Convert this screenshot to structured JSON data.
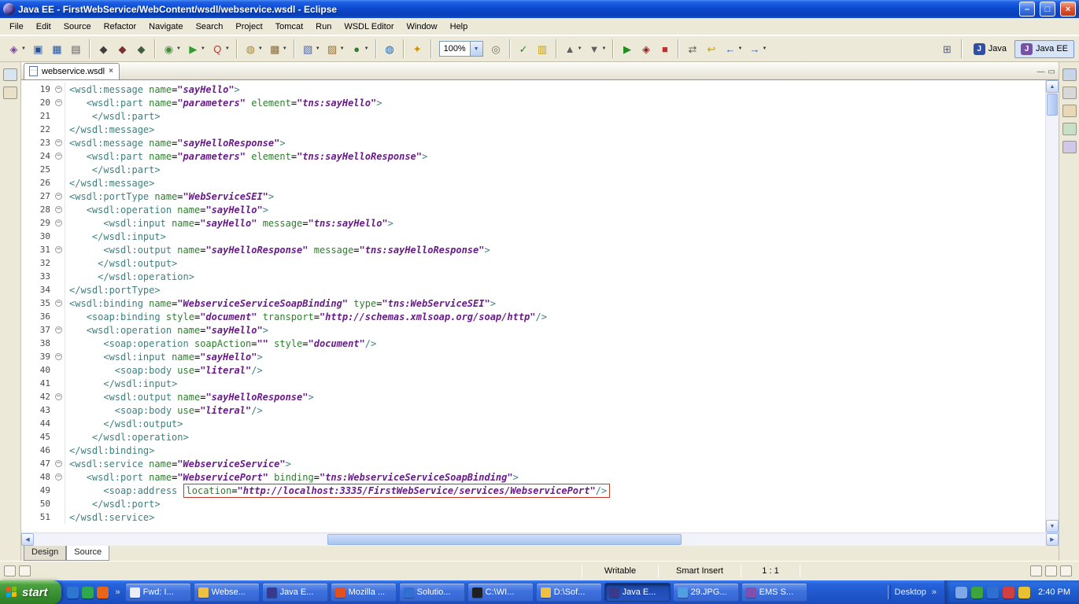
{
  "window": {
    "title": "Java EE - FirstWebService/WebContent/wsdl/webservice.wsdl - Eclipse",
    "controls": {
      "minimize": "–",
      "maximize": "□",
      "close": "×"
    }
  },
  "icons": {
    "dropdown": "▼",
    "up": "▲",
    "down": "▼",
    "left": "◀",
    "right": "▶",
    "overflow": "»"
  },
  "menu": {
    "items": [
      "File",
      "Edit",
      "Source",
      "Refactor",
      "Navigate",
      "Search",
      "Project",
      "Tomcat",
      "Run",
      "WSDL Editor",
      "Window",
      "Help"
    ]
  },
  "toolbar": {
    "zoom_value": "100%",
    "perspectives": [
      {
        "label": "Java"
      },
      {
        "label": "Java EE",
        "active": true
      }
    ],
    "groups": [
      [
        {
          "name": "new-wizard-icon",
          "glyph": "◈",
          "color": "#7B3FA0",
          "dd": true
        },
        {
          "name": "save-icon",
          "glyph": "▣",
          "color": "#24509E"
        },
        {
          "name": "save-all-icon",
          "glyph": "▦",
          "color": "#24509E"
        },
        {
          "name": "print-icon",
          "glyph": "▤",
          "color": "#5A5A5A"
        }
      ],
      [
        {
          "name": "new-ant-build-icon",
          "glyph": "◆",
          "color": "#3E3E3E"
        },
        {
          "name": "ant-debug-icon",
          "glyph": "◆",
          "color": "#7A3030"
        },
        {
          "name": "ant-run-icon",
          "glyph": "◆",
          "color": "#3E5E3E"
        }
      ],
      [
        {
          "name": "debug-icon",
          "glyph": "◉",
          "color": "#3E8E3E",
          "dd": true
        },
        {
          "name": "run-icon",
          "glyph": "▶",
          "color": "#2E9E2E",
          "dd": true
        },
        {
          "name": "external-tools-icon",
          "glyph": "Q",
          "color": "#B03838",
          "dd": true
        }
      ],
      [
        {
          "name": "new-web-service-icon",
          "glyph": "◍",
          "color": "#B8860B",
          "dd": true
        },
        {
          "name": "new-dynamic-web-project-icon",
          "glyph": "▩",
          "color": "#8A6D3B",
          "dd": true
        }
      ],
      [
        {
          "name": "new-java-project-icon",
          "glyph": "▧",
          "color": "#4A6AB0",
          "dd": true
        },
        {
          "name": "new-package-icon",
          "glyph": "▨",
          "color": "#9A7230",
          "dd": true
        },
        {
          "name": "new-class-icon",
          "glyph": "●",
          "color": "#2E7D32",
          "dd": true
        }
      ],
      [
        {
          "name": "web-browser-icon",
          "glyph": "◍",
          "color": "#1565C0"
        }
      ],
      [
        {
          "name": "search-icon",
          "glyph": "✦",
          "color": "#D09000"
        }
      ],
      [
        {
          "type": "zoom"
        },
        {
          "name": "zoom-select-icon",
          "glyph": "◎",
          "color": "#707070"
        }
      ],
      [
        {
          "name": "validate-icon",
          "glyph": "✓",
          "color": "#2E7D32"
        },
        {
          "name": "mark-occurrences-icon",
          "glyph": "▥",
          "color": "#C8A000"
        }
      ],
      [
        {
          "name": "previous-annotation-icon",
          "glyph": "▲",
          "color": "#606060",
          "dd": true
        },
        {
          "name": "next-annotation-icon",
          "glyph": "▼",
          "color": "#606060",
          "dd": true
        }
      ],
      [
        {
          "name": "run-last-icon",
          "glyph": "▶",
          "color": "#1E8E1E"
        },
        {
          "name": "profile-icon",
          "glyph": "◈",
          "color": "#8E1E1E"
        },
        {
          "name": "stop-icon",
          "glyph": "■",
          "color": "#C03030"
        }
      ],
      [
        {
          "name": "link-editor-icon",
          "glyph": "⇄",
          "color": "#606060"
        },
        {
          "name": "last-edit-icon",
          "glyph": "↩",
          "color": "#C8A000"
        },
        {
          "name": "back-icon",
          "glyph": "←",
          "color": "#2B5FC0",
          "dd": true
        },
        {
          "name": "forward-icon",
          "glyph": "→",
          "color": "#2B5FC0",
          "dd": true
        }
      ]
    ]
  },
  "strips": {
    "left": [
      {
        "name": "fast-view-restore-icon",
        "color": "#D8E4F0"
      },
      {
        "name": "fast-view-palette-icon",
        "color": "#E8E0C8"
      }
    ],
    "right": [
      {
        "name": "restore-trim-icon",
        "color": "#C8D4E8"
      },
      {
        "name": "outline-view-icon",
        "color": "#D8D8D8"
      },
      {
        "name": "properties-view-icon",
        "color": "#E8D8B8"
      },
      {
        "name": "servers-view-icon",
        "color": "#C8E0C8"
      },
      {
        "name": "snippets-view-icon",
        "color": "#D0C8E8"
      }
    ]
  },
  "editor": {
    "tab": "webservice.wsdl",
    "tab_close": "×",
    "minimize_glyph": "—",
    "maximize_glyph": "▭",
    "fold_glyph": "−",
    "view_tabs": [
      "Design",
      "Source"
    ],
    "lines": [
      {
        "n": 19,
        "fold": true,
        "text": "<wsdl:message name=\"sayHello\">"
      },
      {
        "n": 20,
        "fold": true,
        "text": "   <wsdl:part name=\"parameters\" element=\"tns:sayHello\">"
      },
      {
        "n": 21,
        "fold": false,
        "text": "    </wsdl:part>"
      },
      {
        "n": 22,
        "fold": false,
        "text": "</wsdl:message>"
      },
      {
        "n": 23,
        "fold": true,
        "text": "<wsdl:message name=\"sayHelloResponse\">"
      },
      {
        "n": 24,
        "fold": true,
        "text": "   <wsdl:part name=\"parameters\" element=\"tns:sayHelloResponse\">"
      },
      {
        "n": 25,
        "fold": false,
        "text": "    </wsdl:part>"
      },
      {
        "n": 26,
        "fold": false,
        "text": "</wsdl:message>"
      },
      {
        "n": 27,
        "fold": true,
        "text": "<wsdl:portType name=\"WebServiceSEI\">"
      },
      {
        "n": 28,
        "fold": true,
        "text": "   <wsdl:operation name=\"sayHello\">"
      },
      {
        "n": 29,
        "fold": true,
        "text": "      <wsdl:input name=\"sayHello\" message=\"tns:sayHello\">"
      },
      {
        "n": 30,
        "fold": false,
        "text": "    </wsdl:input>"
      },
      {
        "n": 31,
        "fold": true,
        "text": "      <wsdl:output name=\"sayHelloResponse\" message=\"tns:sayHelloResponse\">"
      },
      {
        "n": 32,
        "fold": false,
        "text": "     </wsdl:output>"
      },
      {
        "n": 33,
        "fold": false,
        "text": "     </wsdl:operation>"
      },
      {
        "n": 34,
        "fold": false,
        "text": "</wsdl:portType>"
      },
      {
        "n": 35,
        "fold": true,
        "text": "<wsdl:binding name=\"WebserviceServiceSoapBinding\" type=\"tns:WebServiceSEI\">"
      },
      {
        "n": 36,
        "fold": false,
        "text": "   <soap:binding style=\"document\" transport=\"http://schemas.xmlsoap.org/soap/http\"/>"
      },
      {
        "n": 37,
        "fold": true,
        "text": "   <wsdl:operation name=\"sayHello\">"
      },
      {
        "n": 38,
        "fold": false,
        "text": "      <soap:operation soapAction=\"\" style=\"document\"/>"
      },
      {
        "n": 39,
        "fold": true,
        "text": "      <wsdl:input name=\"sayHello\">"
      },
      {
        "n": 40,
        "fold": false,
        "text": "        <soap:body use=\"literal\"/>"
      },
      {
        "n": 41,
        "fold": false,
        "text": "      </wsdl:input>"
      },
      {
        "n": 42,
        "fold": true,
        "text": "      <wsdl:output name=\"sayHelloResponse\">"
      },
      {
        "n": 43,
        "fold": false,
        "text": "        <soap:body use=\"literal\"/>"
      },
      {
        "n": 44,
        "fold": false,
        "text": "      </wsdl:output>"
      },
      {
        "n": 45,
        "fold": false,
        "text": "    </wsdl:operation>"
      },
      {
        "n": 46,
        "fold": false,
        "text": "</wsdl:binding>"
      },
      {
        "n": 47,
        "fold": true,
        "text": "<wsdl:service name=\"WebserviceService\">"
      },
      {
        "n": 48,
        "fold": true,
        "text": "   <wsdl:port name=\"WebservicePort\" binding=\"tns:WebserviceServiceSoapBinding\">"
      },
      {
        "n": 49,
        "fold": false,
        "text": "      <soap:address location=\"http://localhost:3335/FirstWebService/services/WebservicePort\"/>",
        "hl": "location="
      },
      {
        "n": 50,
        "fold": false,
        "text": "    </wsdl:port>"
      },
      {
        "n": 51,
        "fold": false,
        "text": "</wsdl:service>"
      }
    ]
  },
  "status": {
    "writable": "Writable",
    "insert_mode": "Smart Insert",
    "position": "1 : 1"
  },
  "taskbar": {
    "start_label": "start",
    "quick_launch": [
      {
        "name": "internet-explorer-icon",
        "color": "#2E77D0"
      },
      {
        "name": "browser-icon",
        "color": "#2FA84F"
      },
      {
        "name": "firefox-icon",
        "color": "#E8651A"
      }
    ],
    "buttons": [
      {
        "label": "Fwd: I...",
        "icon": "mail-icon",
        "color": "#EDEDF5"
      },
      {
        "label": "Webse...",
        "icon": "folder-icon",
        "color": "#F0C040"
      },
      {
        "label": "Java E...",
        "icon": "eclipse-icon",
        "color": "#3A3A8C"
      },
      {
        "label": "Mozilla ...",
        "icon": "mozilla-icon",
        "color": "#E05020"
      },
      {
        "label": "Solutio...",
        "icon": "document-icon",
        "color": "#3070D0"
      },
      {
        "label": "C:\\WI...",
        "icon": "command-prompt-icon",
        "color": "#202020"
      },
      {
        "label": "D:\\Sof...",
        "icon": "explorer-folder-icon",
        "color": "#F0C040"
      },
      {
        "label": "Java E...",
        "icon": "eclipse-icon",
        "color": "#3A3A8C",
        "active": true
      },
      {
        "label": "29.JPG...",
        "icon": "image-viewer-icon",
        "color": "#50A0E0"
      },
      {
        "label": "EMS S...",
        "icon": "application-icon",
        "color": "#8050B0"
      }
    ],
    "desktop_label": "Desktop",
    "tray_icons": [
      {
        "name": "volume-icon",
        "color": "#7FA8E8"
      },
      {
        "name": "network-icon",
        "color": "#3DA53D"
      },
      {
        "name": "messenger-icon",
        "color": "#2E6FD0"
      },
      {
        "name": "antivirus-icon",
        "color": "#D04040"
      },
      {
        "name": "updates-icon",
        "color": "#E8C030"
      }
    ],
    "clock": "2:40 PM"
  }
}
